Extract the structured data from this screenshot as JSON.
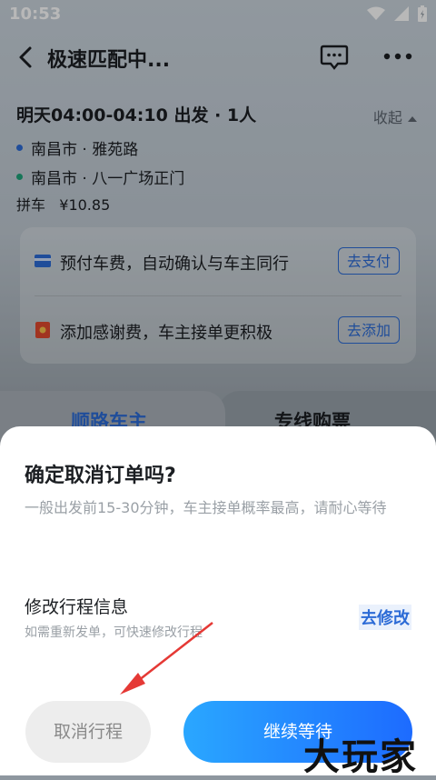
{
  "status": {
    "time": "10:53"
  },
  "nav": {
    "title": "极速匹配中..."
  },
  "trip": {
    "time_line": "明天04:00-04:10 出发 · 1人",
    "collapse_label": "收起",
    "from": "南昌市 · 雅苑路",
    "to": "南昌市 · 八一广场正门",
    "fare": "拼车   ¥10.85"
  },
  "actions": [
    {
      "text": "预付车费，自动确认与车主同行",
      "button": "去支付"
    },
    {
      "text": "添加感谢费，车主接单更积极",
      "button": "去添加"
    }
  ],
  "tabs": {
    "left": "顺路车主",
    "right": "专线购票"
  },
  "sheet": {
    "title": "确定取消订单吗?",
    "desc": "一般出发前15-30分钟，车主接单概率最高，请耐心等待",
    "modify_title": "修改行程信息",
    "modify_sub": "如需重新发单，可快速修改行程",
    "modify_link": "去修改",
    "cancel_button": "取消行程",
    "continue_button": "继续等待"
  },
  "watermark": "大玩家",
  "colors": {
    "accent": "#2c6bd6",
    "from_dot": "#2c6bd6",
    "to_dot": "#1fa37a",
    "button_gradient_start": "#2aa7ff",
    "button_gradient_end": "#1d6bff",
    "arrow": "#e53935"
  },
  "icons": [
    "wifi-icon",
    "signal-icon",
    "battery-icon",
    "back-icon",
    "message-icon",
    "more-icon",
    "card-icon",
    "red-envelope-icon",
    "caret-up-icon"
  ]
}
